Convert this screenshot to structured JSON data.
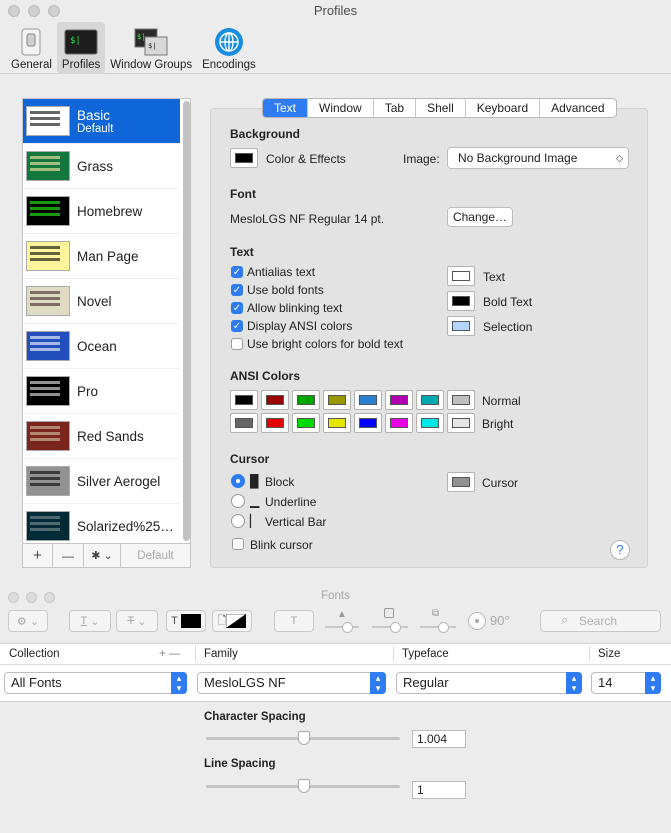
{
  "window": {
    "title": "Profiles"
  },
  "toolbar": [
    {
      "label": "General",
      "icon": "general-switch-icon"
    },
    {
      "label": "Profiles",
      "icon": "terminal-profile-icon",
      "active": true
    },
    {
      "label": "Window Groups",
      "icon": "window-groups-icon"
    },
    {
      "label": "Encodings",
      "icon": "globe-icon"
    }
  ],
  "profiles": [
    {
      "name": "Basic",
      "sub": "Default",
      "bg": "#ffffff",
      "fg": "#000000",
      "selected": true
    },
    {
      "name": "Grass",
      "bg": "#13773d",
      "fg": "#fff0a5"
    },
    {
      "name": "Homebrew",
      "bg": "#000000",
      "fg": "#28fe14"
    },
    {
      "name": "Man Page",
      "bg": "#fef49c",
      "fg": "#000000"
    },
    {
      "name": "Novel",
      "bg": "#dfdbc3",
      "fg": "#3b2322"
    },
    {
      "name": "Ocean",
      "bg": "#224fbc",
      "fg": "#ffffff"
    },
    {
      "name": "Pro",
      "bg": "#000000",
      "fg": "#f2f2f2"
    },
    {
      "name": "Red Sands",
      "bg": "#7a251e",
      "fg": "#d7c9a7"
    },
    {
      "name": "Silver Aerogel",
      "bg": "#929292",
      "fg": "#000000"
    },
    {
      "name": "Solarized%25…",
      "bg": "#002b36",
      "fg": "#839496"
    }
  ],
  "list_footer": {
    "add": "+",
    "remove": "—",
    "gear": "✱ ⌄",
    "default": "Default"
  },
  "tabs": [
    "Text",
    "Window",
    "Tab",
    "Shell",
    "Keyboard",
    "Advanced"
  ],
  "background": {
    "title": "Background",
    "color_label": "Color & Effects",
    "image_label": "Image:",
    "image_value": "No Background Image"
  },
  "font": {
    "title": "Font",
    "value": "MesloLGS NF Regular 14 pt.",
    "change": "Change…"
  },
  "text": {
    "title": "Text",
    "checkboxes": [
      {
        "label": "Antialias text",
        "checked": true
      },
      {
        "label": "Use bold fonts",
        "checked": true
      },
      {
        "label": "Allow blinking text",
        "checked": true
      },
      {
        "label": "Display ANSI colors",
        "checked": true
      },
      {
        "label": "Use bright colors for bold text",
        "checked": false
      }
    ],
    "swatches": [
      {
        "label": "Text",
        "color": "#ffffff"
      },
      {
        "label": "Bold Text",
        "color": "#000000"
      },
      {
        "label": "Selection",
        "color": "#b4d5fe"
      }
    ]
  },
  "ansi": {
    "title": "ANSI Colors",
    "normal_label": "Normal",
    "bright_label": "Bright",
    "normal": [
      "#000000",
      "#990000",
      "#00a600",
      "#999900",
      "#2d7fd1",
      "#b200b2",
      "#00a6b2",
      "#bfbfbf"
    ],
    "bright": [
      "#666666",
      "#e50000",
      "#00d900",
      "#e5e500",
      "#0000ff",
      "#e500e5",
      "#00e5e5",
      "#e5e5e5"
    ]
  },
  "cursor": {
    "title": "Cursor",
    "options": [
      {
        "glyph": "█",
        "label": "Block",
        "selected": true
      },
      {
        "glyph": "▁",
        "label": "Underline",
        "selected": false
      },
      {
        "glyph": "▏",
        "label": "Vertical Bar",
        "selected": false
      }
    ],
    "blink_label": "Blink cursor",
    "color_label": "Cursor",
    "color": "#929292"
  },
  "help": "?",
  "fonts_window": {
    "title": "Fonts",
    "rotation": "90°",
    "search_placeholder": "Search",
    "columns": {
      "collection": "Collection",
      "plusminus": "+ —",
      "family": "Family",
      "typeface": "Typeface",
      "size": "Size"
    },
    "collection": "All Fonts",
    "family": "MesloLGS NF",
    "typeface": "Regular",
    "size": "14",
    "character_spacing_label": "Character Spacing",
    "character_spacing": "1.004",
    "line_spacing_label": "Line Spacing",
    "line_spacing": "1"
  }
}
